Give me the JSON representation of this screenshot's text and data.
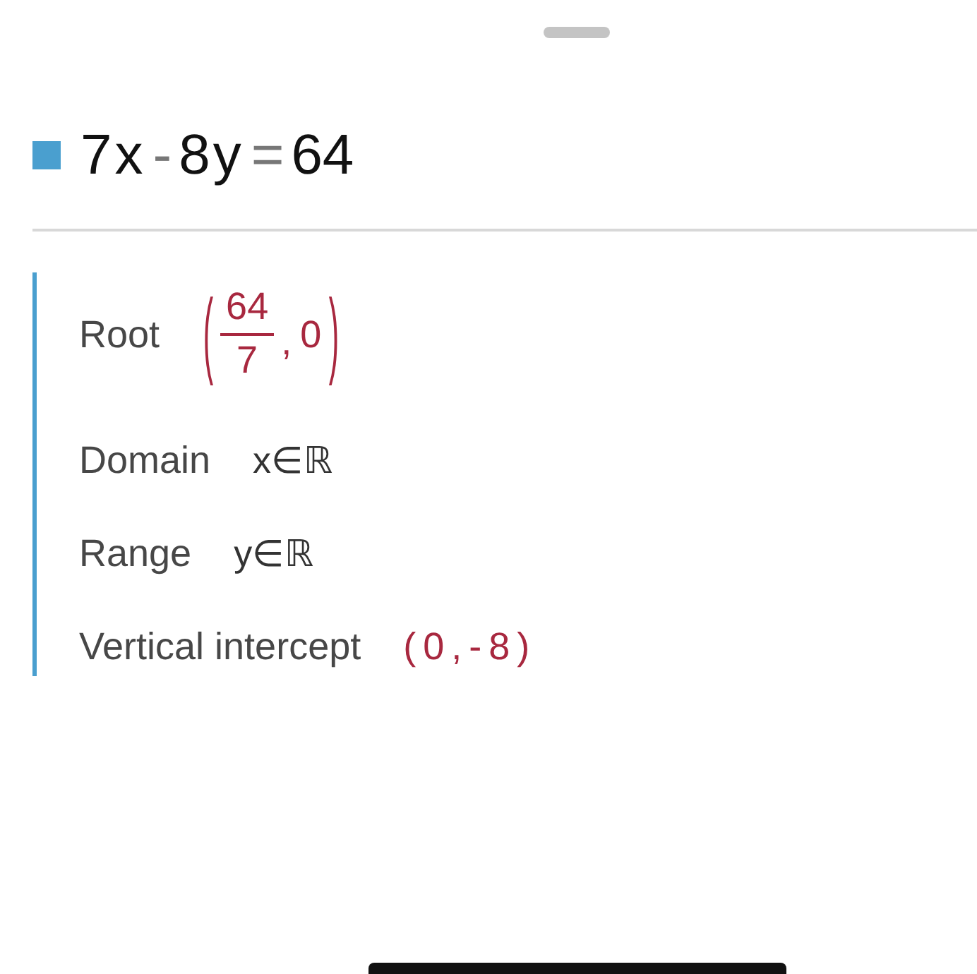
{
  "equation": {
    "tokens": [
      {
        "text": "7",
        "kind": "number"
      },
      {
        "text": "x",
        "kind": "variable"
      },
      {
        "text": "-",
        "kind": "operator"
      },
      {
        "text": "8",
        "kind": "number"
      },
      {
        "text": "y",
        "kind": "variable"
      },
      {
        "text": "=",
        "kind": "operator"
      },
      {
        "text": "64",
        "kind": "number"
      }
    ]
  },
  "properties": [
    {
      "label": "Root",
      "kind": "fraction_point",
      "value": {
        "open": "(",
        "numerator": "64",
        "denominator": "7",
        "separator": ",",
        "second": "0",
        "close": ")"
      }
    },
    {
      "label": "Domain",
      "kind": "set",
      "value": "x∈ℝ"
    },
    {
      "label": "Range",
      "kind": "set",
      "value": "y∈ℝ"
    },
    {
      "label": "Vertical intercept",
      "kind": "point",
      "value": "(0,-8)"
    }
  ]
}
